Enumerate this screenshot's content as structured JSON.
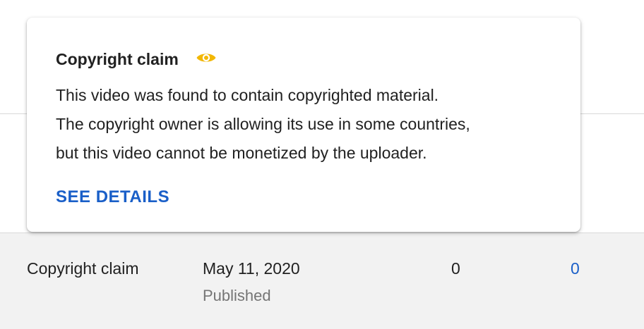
{
  "popover": {
    "title": "Copyright claim",
    "icon": "eye-icon",
    "icon_color": "#f2b705",
    "body_lines": [
      "This video was found to contain copyrighted material.",
      "The copyright owner is allowing its use in some countries,",
      "but this video cannot be monetized by the uploader."
    ],
    "action_label": "SEE DETAILS",
    "action_color": "#1a5fc8"
  },
  "row": {
    "restriction": "Copyright claim",
    "date": "May 11, 2020",
    "status": "Published",
    "views": "0",
    "comments": "0"
  }
}
